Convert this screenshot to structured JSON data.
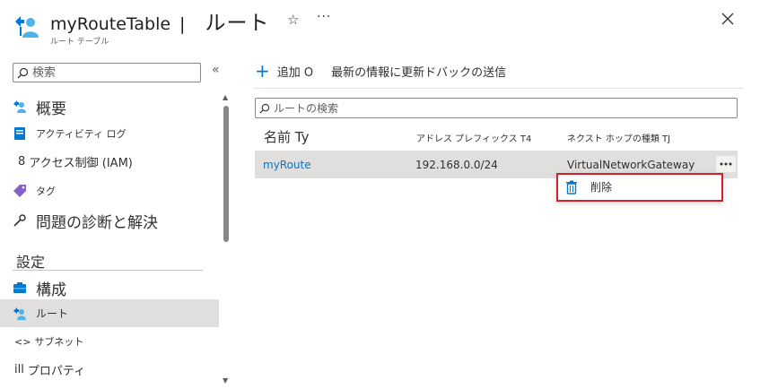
{
  "header": {
    "resource_name": "myRouteTable",
    "separator": "|",
    "page_title": "ルート",
    "subtitle": "ルート テーブル",
    "favorite_glyph": "☆",
    "more_glyph": "···",
    "icon": "route-table-icon"
  },
  "sidebar": {
    "search_placeholder": "検索",
    "collapse_glyph": "«",
    "items": [
      {
        "label": "概要",
        "icon": "overview-icon"
      },
      {
        "label": "アクティビティ ログ",
        "icon": "activity-log-icon"
      },
      {
        "prefix": "8",
        "label": "アクセス制御 (IAM)"
      },
      {
        "label": "タグ",
        "icon": "tag-icon"
      },
      {
        "label": "問題の診断と解決",
        "icon": "wrench-icon"
      },
      {
        "label": "構成",
        "icon": "configuration-icon"
      },
      {
        "label": "ルート",
        "icon": "route-icon",
        "active": true
      },
      {
        "prefix": "<>",
        "label": "サブネット"
      },
      {
        "prefix": "ill",
        "label": "プロパティ"
      }
    ],
    "section_label": "設定"
  },
  "toolbar": {
    "add_label": "追加 O",
    "refresh_label": "最新の情報に更新",
    "feedback_label": "ドバックの送信"
  },
  "search": {
    "placeholder": "ルートの検索"
  },
  "table": {
    "columns": [
      "名前 Ty",
      "アドレス プレフィックス T4",
      "ネクスト ホップの種類 TJ"
    ],
    "rows": [
      {
        "name": "myRoute",
        "address_prefix": "192.168.0.0/24",
        "next_hop_type": "VirtualNetworkGateway"
      }
    ]
  },
  "context_menu": {
    "items": [
      {
        "label": "削除",
        "icon": "trash-icon"
      }
    ]
  },
  "colors": {
    "accent": "#0078d4",
    "highlight_border": "#d21f2a",
    "selected_bg": "#e1dfdd"
  }
}
